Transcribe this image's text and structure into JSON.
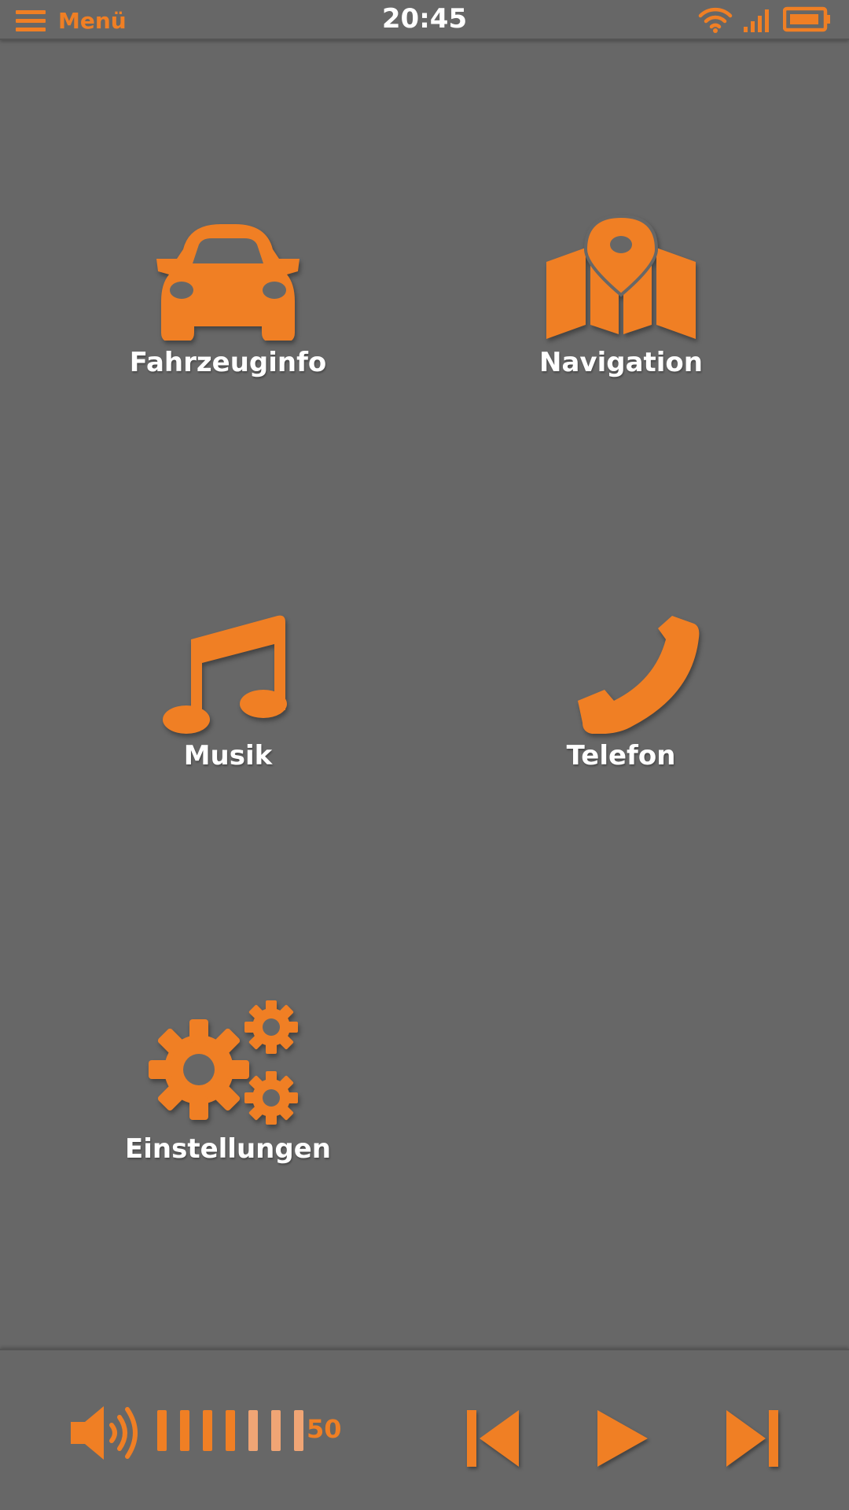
{
  "status_bar": {
    "menu_label": "Menü",
    "time": "20:45",
    "icons": [
      "hamburger-menu-icon",
      "wifi-icon",
      "signal-icon",
      "battery-icon"
    ]
  },
  "tiles": [
    {
      "label": "Fahrzeuginfo",
      "icon": "car-icon"
    },
    {
      "label": "Navigation",
      "icon": "map-pin-icon"
    },
    {
      "label": "Musik",
      "icon": "music-note-icon"
    },
    {
      "label": "Telefon",
      "icon": "phone-icon"
    },
    {
      "label": "Einstellungen",
      "icon": "gears-icon"
    }
  ],
  "bottom_bar": {
    "volume_value": "50",
    "volume_level": 0.5,
    "controls": [
      "previous-track-icon",
      "play-icon",
      "next-track-icon"
    ]
  },
  "colors": {
    "accent": "#F07F24",
    "accent_dim": "#F0A575",
    "background": "#676767",
    "text": "#FFFFFF"
  }
}
